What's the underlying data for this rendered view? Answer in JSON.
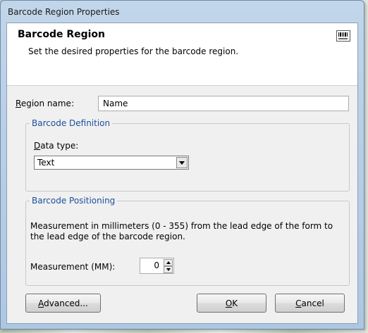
{
  "window": {
    "title": "Barcode Region Properties"
  },
  "header": {
    "title": "Barcode Region",
    "subtitle": "Set the desired properties for the barcode region.",
    "icon": "barcode-icon"
  },
  "region_name": {
    "label_accel": "R",
    "label_rest": "egion name:",
    "value": "Name"
  },
  "barcode_definition": {
    "legend": "Barcode Definition",
    "data_type_label_accel": "D",
    "data_type_label_rest": "ata type:",
    "data_type_value": "Text"
  },
  "barcode_positioning": {
    "legend": "Barcode Positioning",
    "description": "Measurement in millimeters (0 - 355) from the lead edge of the form to the lead edge of the barcode region.",
    "measurement_label": "Measurement (MM):",
    "measurement_value": "0"
  },
  "buttons": {
    "advanced_accel": "A",
    "advanced_rest": "dvanced...",
    "ok_accel": "O",
    "ok_rest": "K",
    "cancel_accel": "C",
    "cancel_rest": "ancel"
  }
}
